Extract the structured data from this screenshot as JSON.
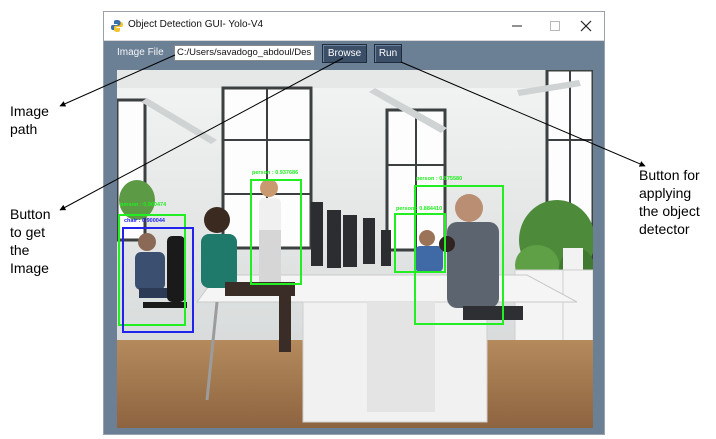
{
  "window": {
    "title": "Object Detection GUI- Yolo-V4",
    "controls": {
      "minimize": "—",
      "maximize": "☐",
      "close": "✕"
    }
  },
  "toolbar": {
    "image_file_label": "Image File",
    "path_value": "C:/Users/savadogo_abdoul/Des",
    "browse_label": "Browse",
    "run_label": "Run"
  },
  "detections": [
    {
      "label": "person : 0.937686",
      "color": "#22ee22"
    },
    {
      "label": "person : 0.875580",
      "color": "#22ee22"
    },
    {
      "label": "person : 0.884410",
      "color": "#22ee22"
    },
    {
      "label": "person : 0.900474",
      "color": "#22ee22"
    },
    {
      "label": "chair : 0.900044",
      "color": "#2222ee"
    }
  ],
  "annotations": {
    "image_path": [
      "Image",
      "path"
    ],
    "get_image": [
      "Button",
      "to get",
      "the",
      "Image"
    ],
    "apply_detector": [
      "Button for",
      "applying",
      "the object",
      "detector"
    ]
  }
}
